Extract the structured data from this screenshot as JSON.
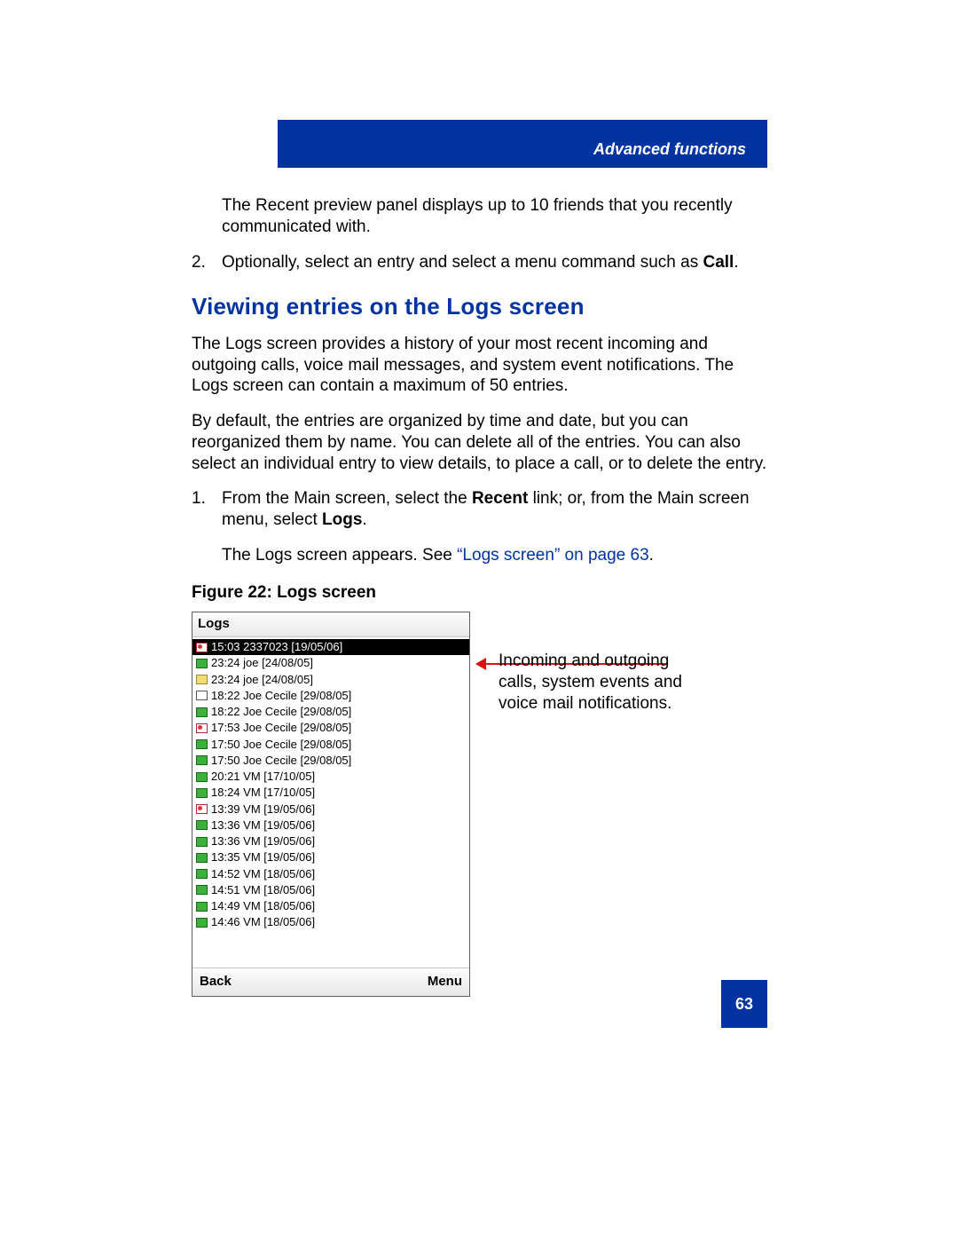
{
  "header": {
    "section_title": "Advanced functions"
  },
  "intro": {
    "p0": "The Recent preview panel displays up to 10 friends that you recently communicated with.",
    "step2_num": "2.",
    "step2_a": "Optionally, select an entry and select a menu command such as ",
    "step2_b": "Call",
    "step2_c": "."
  },
  "section": {
    "heading": "Viewing entries on the Logs screen",
    "p1": "The Logs screen provides a history of your most recent incoming and outgoing calls, voice mail messages, and system event notifications. The Logs screen can contain a maximum of 50 entries.",
    "p2": "By default, the entries are organized by time and date, but you can reorganized them by name. You can delete all of the entries. You can also select an individual entry to view details, to place a call, or to delete the entry.",
    "s1_num": "1.",
    "s1_a": "From the Main screen, select the ",
    "s1_b": "Recent",
    "s1_c": " link; or, from the Main screen menu, select ",
    "s1_d": "Logs",
    "s1_e": ".",
    "appears_a": "The Logs screen appears. See ",
    "appears_link": "“Logs screen” on page 63",
    "appears_b": "."
  },
  "figure": {
    "caption": "Figure 22: Logs screen",
    "annotation": "Incoming and outgoing calls, system events and voice mail notifications.",
    "screen_title": "Logs",
    "softkey_left": "Back",
    "softkey_right": "Menu",
    "entries": [
      {
        "icon": "red",
        "text": "15:03 2337023 [19/05/06]",
        "selected": true
      },
      {
        "icon": "green",
        "text": "23:24 joe [24/08/05]"
      },
      {
        "icon": "yellow",
        "text": "23:24 joe [24/08/05]"
      },
      {
        "icon": "white",
        "text": "18:22 Joe Cecile [29/08/05]"
      },
      {
        "icon": "green",
        "text": "18:22 Joe Cecile [29/08/05]"
      },
      {
        "icon": "red",
        "text": "17:53 Joe Cecile [29/08/05]"
      },
      {
        "icon": "green",
        "text": "17:50 Joe Cecile [29/08/05]"
      },
      {
        "icon": "green",
        "text": "17:50 Joe Cecile [29/08/05]"
      },
      {
        "icon": "green",
        "text": "20:21 VM [17/10/05]"
      },
      {
        "icon": "green",
        "text": "18:24 VM [17/10/05]"
      },
      {
        "icon": "red",
        "text": "13:39 VM [19/05/06]"
      },
      {
        "icon": "green",
        "text": "13:36 VM [19/05/06]"
      },
      {
        "icon": "green",
        "text": "13:36 VM [19/05/06]"
      },
      {
        "icon": "green",
        "text": "13:35 VM [19/05/06]"
      },
      {
        "icon": "green",
        "text": "14:52 VM [18/05/06]"
      },
      {
        "icon": "green",
        "text": "14:51 VM [18/05/06]"
      },
      {
        "icon": "green",
        "text": "14:49 VM [18/05/06]"
      },
      {
        "icon": "green",
        "text": "14:46 VM [18/05/06]"
      }
    ]
  },
  "page_number": "63"
}
